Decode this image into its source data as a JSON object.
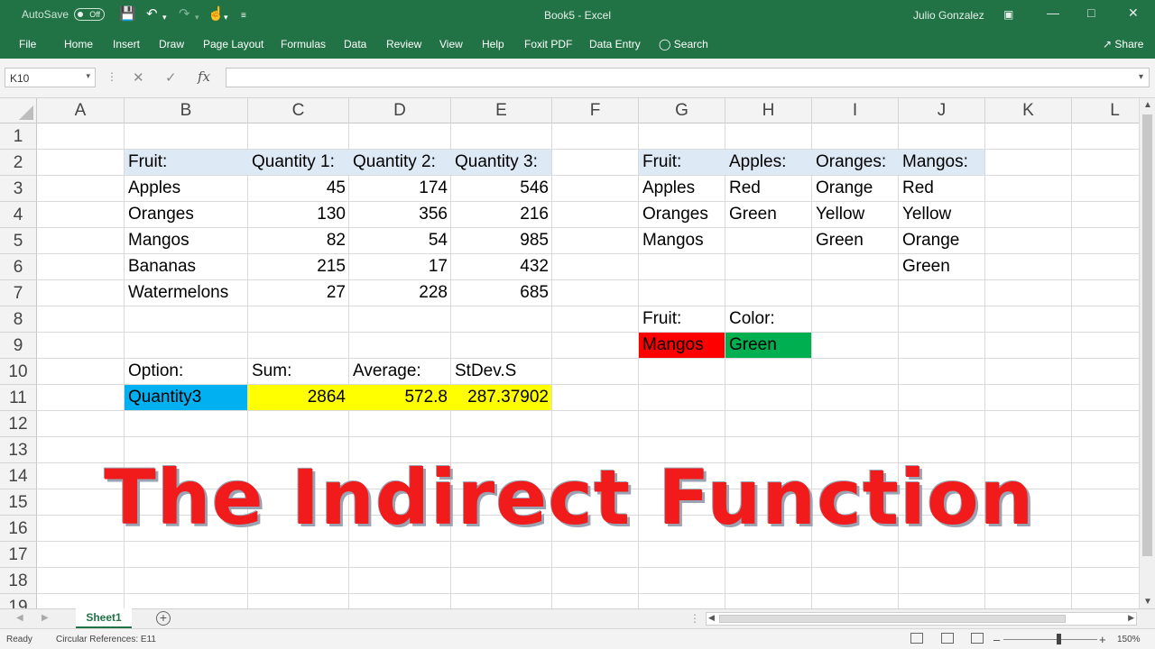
{
  "titlebar": {
    "autosave_label": "AutoSave",
    "autosave_state": "Off",
    "doc_title": "Book5  -  Excel",
    "user": "Julio Gonzalez"
  },
  "ribbon": {
    "tabs": [
      "File",
      "Home",
      "Insert",
      "Draw",
      "Page Layout",
      "Formulas",
      "Data",
      "Review",
      "View",
      "Help",
      "Foxit PDF",
      "Data Entry",
      "Search"
    ],
    "share": "Share"
  },
  "formula_bar": {
    "name_box": "K10",
    "fx": "fx",
    "formula": ""
  },
  "columns": [
    "A",
    "B",
    "C",
    "D",
    "E",
    "F",
    "G",
    "H",
    "I",
    "J",
    "K",
    "L"
  ],
  "rows": [
    "1",
    "2",
    "3",
    "4",
    "5",
    "6",
    "7",
    "8",
    "9",
    "10",
    "11",
    "12",
    "13",
    "14",
    "15",
    "16",
    "17",
    "18",
    "19"
  ],
  "cells": {
    "B2": "Fruit:",
    "C2": "Quantity 1:",
    "D2": "Quantity 2:",
    "E2": "Quantity 3:",
    "B3": "Apples",
    "C3": "45",
    "D3": "174",
    "E3": "546",
    "B4": "Oranges",
    "C4": "130",
    "D4": "356",
    "E4": "216",
    "B5": "Mangos",
    "C5": "82",
    "D5": "54",
    "E5": "985",
    "B6": "Bananas",
    "C6": "215",
    "D6": "17",
    "E6": "432",
    "B7": "Watermelons",
    "C7": "27",
    "D7": "228",
    "E7": "685",
    "B10": "Option:",
    "C10": "Sum:",
    "D10": "Average:",
    "E10": "StDev.S",
    "B11": "Quantity3",
    "C11": "2864",
    "D11": "572.8",
    "E11": "287.37902",
    "G2": "Fruit:",
    "H2": "Apples:",
    "I2": "Oranges:",
    "J2": "Mangos:",
    "G3": "Apples",
    "H3": "Red",
    "I3": "Orange",
    "J3": "Red",
    "G4": "Oranges",
    "H4": "Green",
    "I4": "Yellow",
    "J4": "Yellow",
    "G5": "Mangos",
    "I5": "Green",
    "J5": "Orange",
    "J6": "Green",
    "G8": "Fruit:",
    "H8": "Color:",
    "G9": "Mangos",
    "H9": "Green"
  },
  "fills": {
    "header_blue": "#dde9f5",
    "option_blue": "#00b0f0",
    "result_yellow": "#ffff00",
    "fruit_red": "#ff0000",
    "color_green": "#00b050"
  },
  "banner": "The Indirect Function",
  "sheets": {
    "active": "Sheet1"
  },
  "status": {
    "ready": "Ready",
    "circular": "Circular References: E11",
    "zoom": "150%"
  }
}
